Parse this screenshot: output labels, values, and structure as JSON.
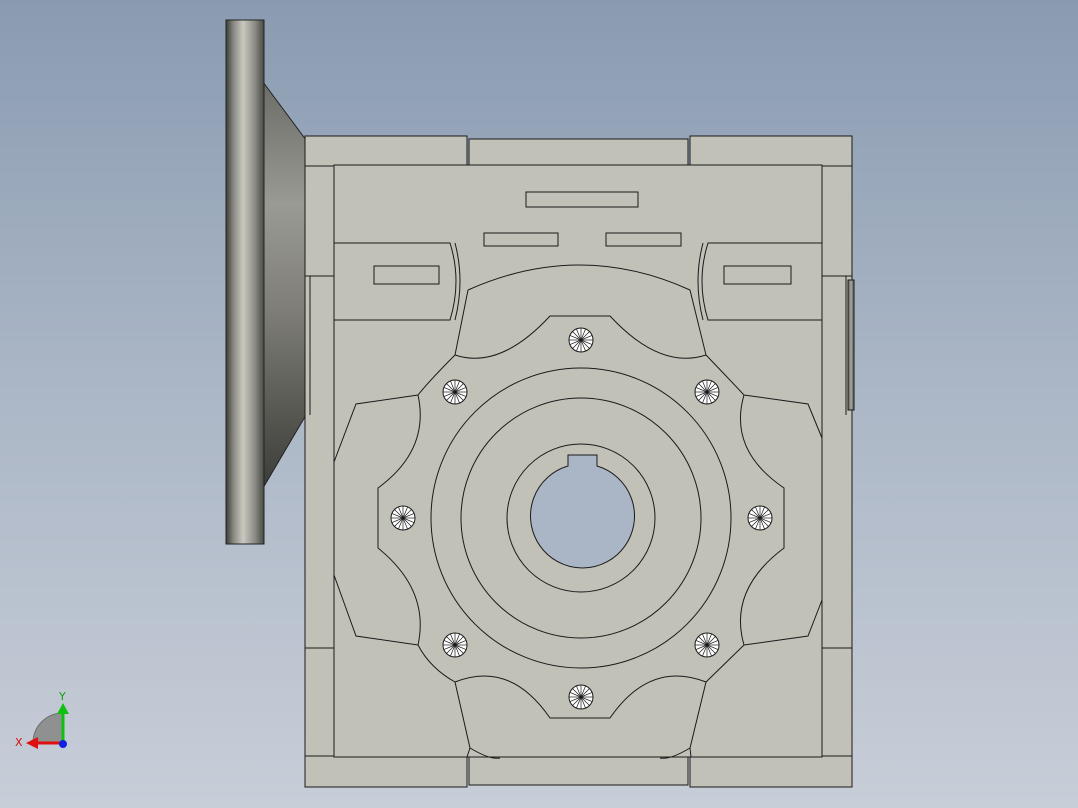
{
  "view": {
    "background_top": "#8a9bb1",
    "background_bottom": "#c8ced8",
    "part_fill": "#c2c1b8",
    "edge_color": "#1a1a1a",
    "bore_fill": "#aab6c6"
  },
  "triad": {
    "x_label": "X",
    "y_label": "Y",
    "x_color": "#e01010",
    "y_color": "#10c010",
    "z_color": "#1020e0"
  }
}
